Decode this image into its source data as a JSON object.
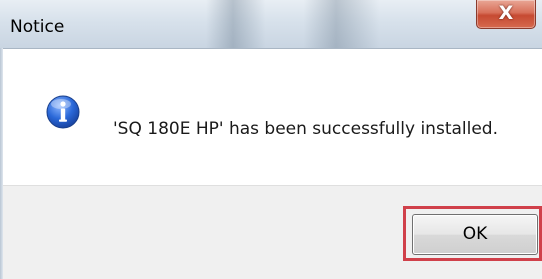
{
  "window": {
    "title": "Notice",
    "close_label": "X"
  },
  "dialog": {
    "icon": "info-icon",
    "message": "'SQ 180E HP' has been successfully installed.",
    "ok_label": "OK"
  },
  "colors": {
    "info_icon_blue": "#1f5fd0",
    "highlight_red": "#d0404a",
    "close_button_red": "#c64a32"
  }
}
